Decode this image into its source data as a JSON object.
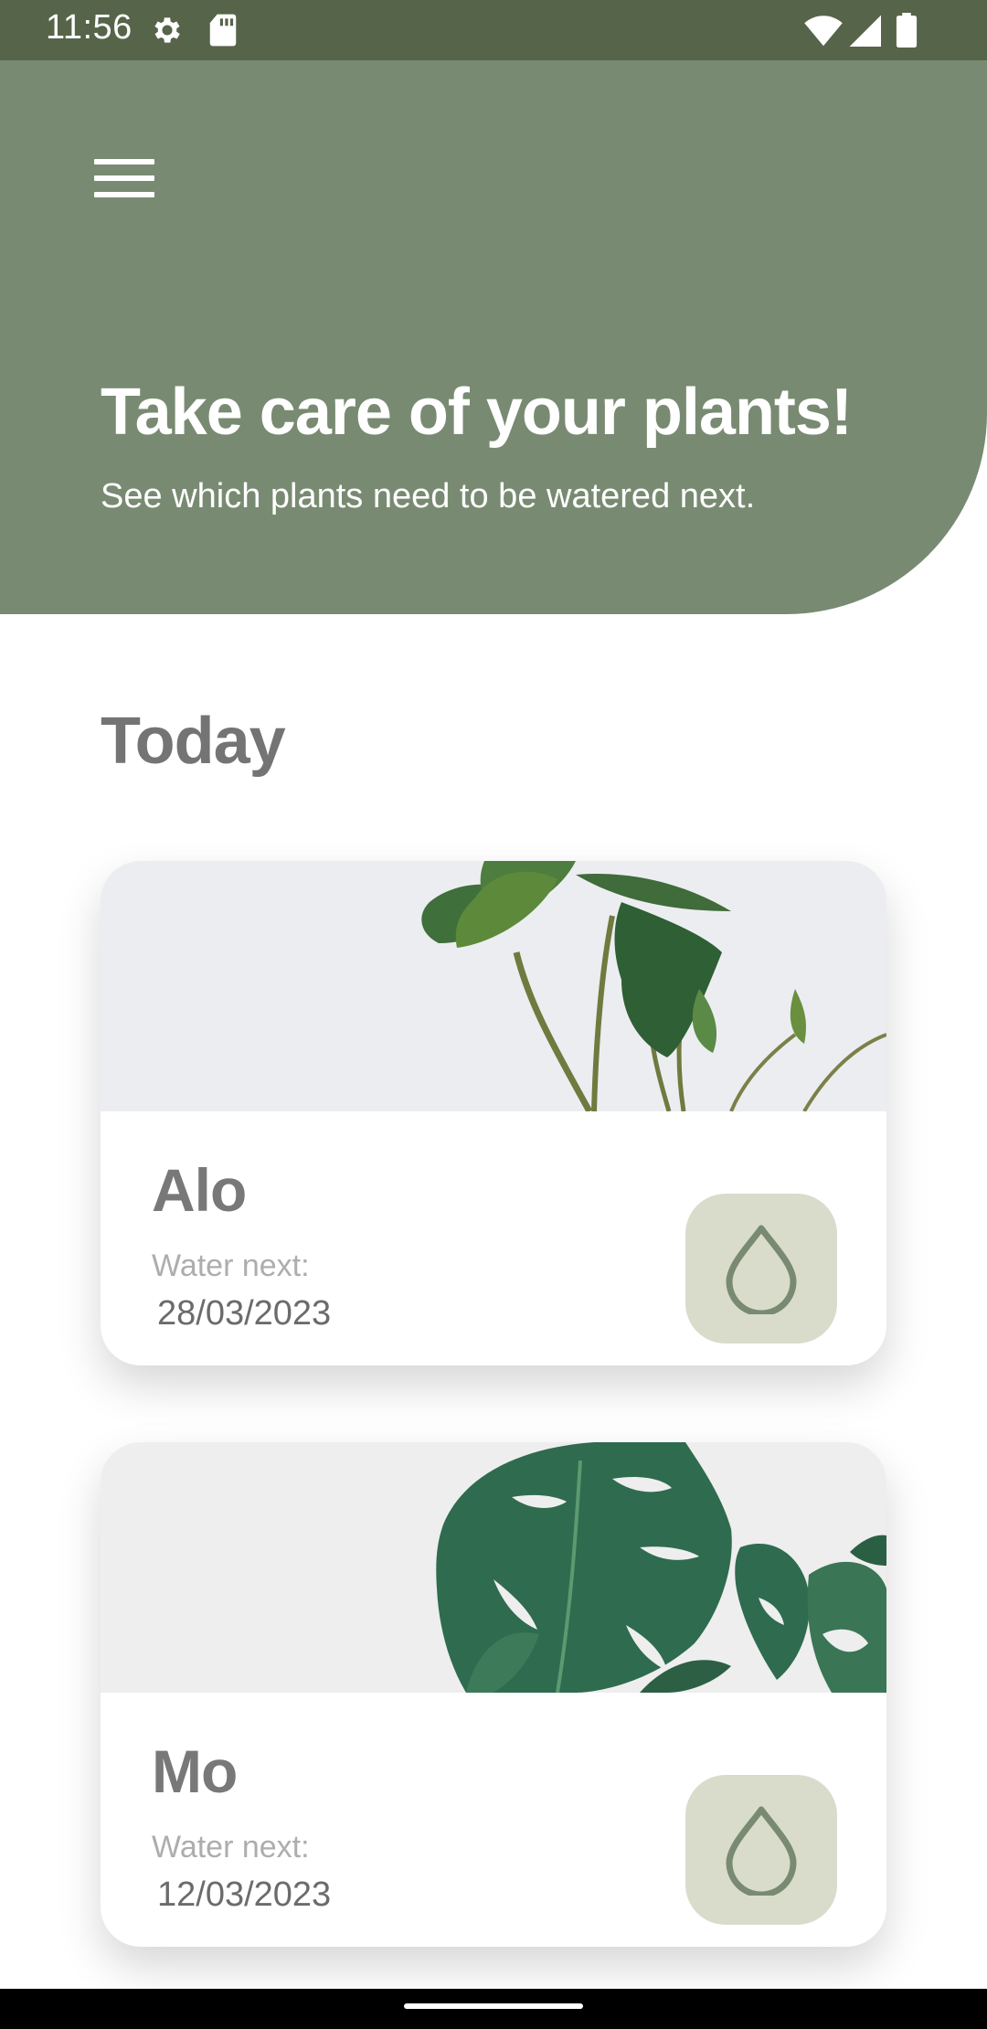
{
  "status_bar": {
    "time": "11:56",
    "icons": [
      "gear-icon",
      "sd-card-icon",
      "wifi-icon",
      "signal-icon",
      "battery-icon"
    ]
  },
  "header": {
    "menu_icon": "menu-icon",
    "title": "Take care of your plants!",
    "subtitle": "See which plants need to be watered next."
  },
  "section": {
    "title": "Today"
  },
  "plants": [
    {
      "name": "Alo",
      "water_label": "Water next:",
      "water_date": "28/03/2023",
      "image": "alocasia-plant-image",
      "action_icon": "water-drop-icon"
    },
    {
      "name": "Mo",
      "water_label": "Water next:",
      "water_date": "12/03/2023",
      "image": "monstera-plant-image",
      "action_icon": "water-drop-icon"
    }
  ],
  "colors": {
    "status_bar": "#566449",
    "header": "#798a72",
    "water_button": "#d9dccb",
    "water_icon": "#798a72",
    "section_title": "#747474"
  }
}
